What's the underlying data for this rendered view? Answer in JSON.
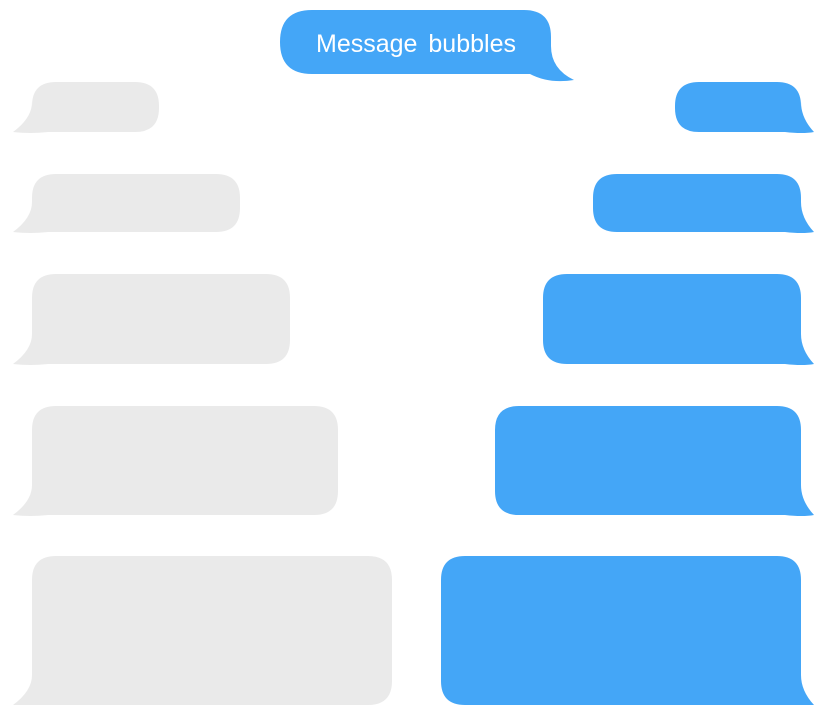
{
  "title": {
    "text": "Message bubbles"
  },
  "colors": {
    "background": "#ffffff",
    "incoming_bubble": "#eaeaea",
    "outgoing_bubble": "#44a6f7",
    "title_text": "#ffffff"
  },
  "bubbles": {
    "incoming": [
      {
        "kind": "incoming"
      },
      {
        "kind": "incoming"
      },
      {
        "kind": "incoming"
      },
      {
        "kind": "incoming"
      },
      {
        "kind": "incoming"
      }
    ],
    "outgoing": [
      {
        "kind": "outgoing"
      },
      {
        "kind": "outgoing"
      },
      {
        "kind": "outgoing"
      },
      {
        "kind": "outgoing"
      },
      {
        "kind": "outgoing"
      }
    ]
  }
}
